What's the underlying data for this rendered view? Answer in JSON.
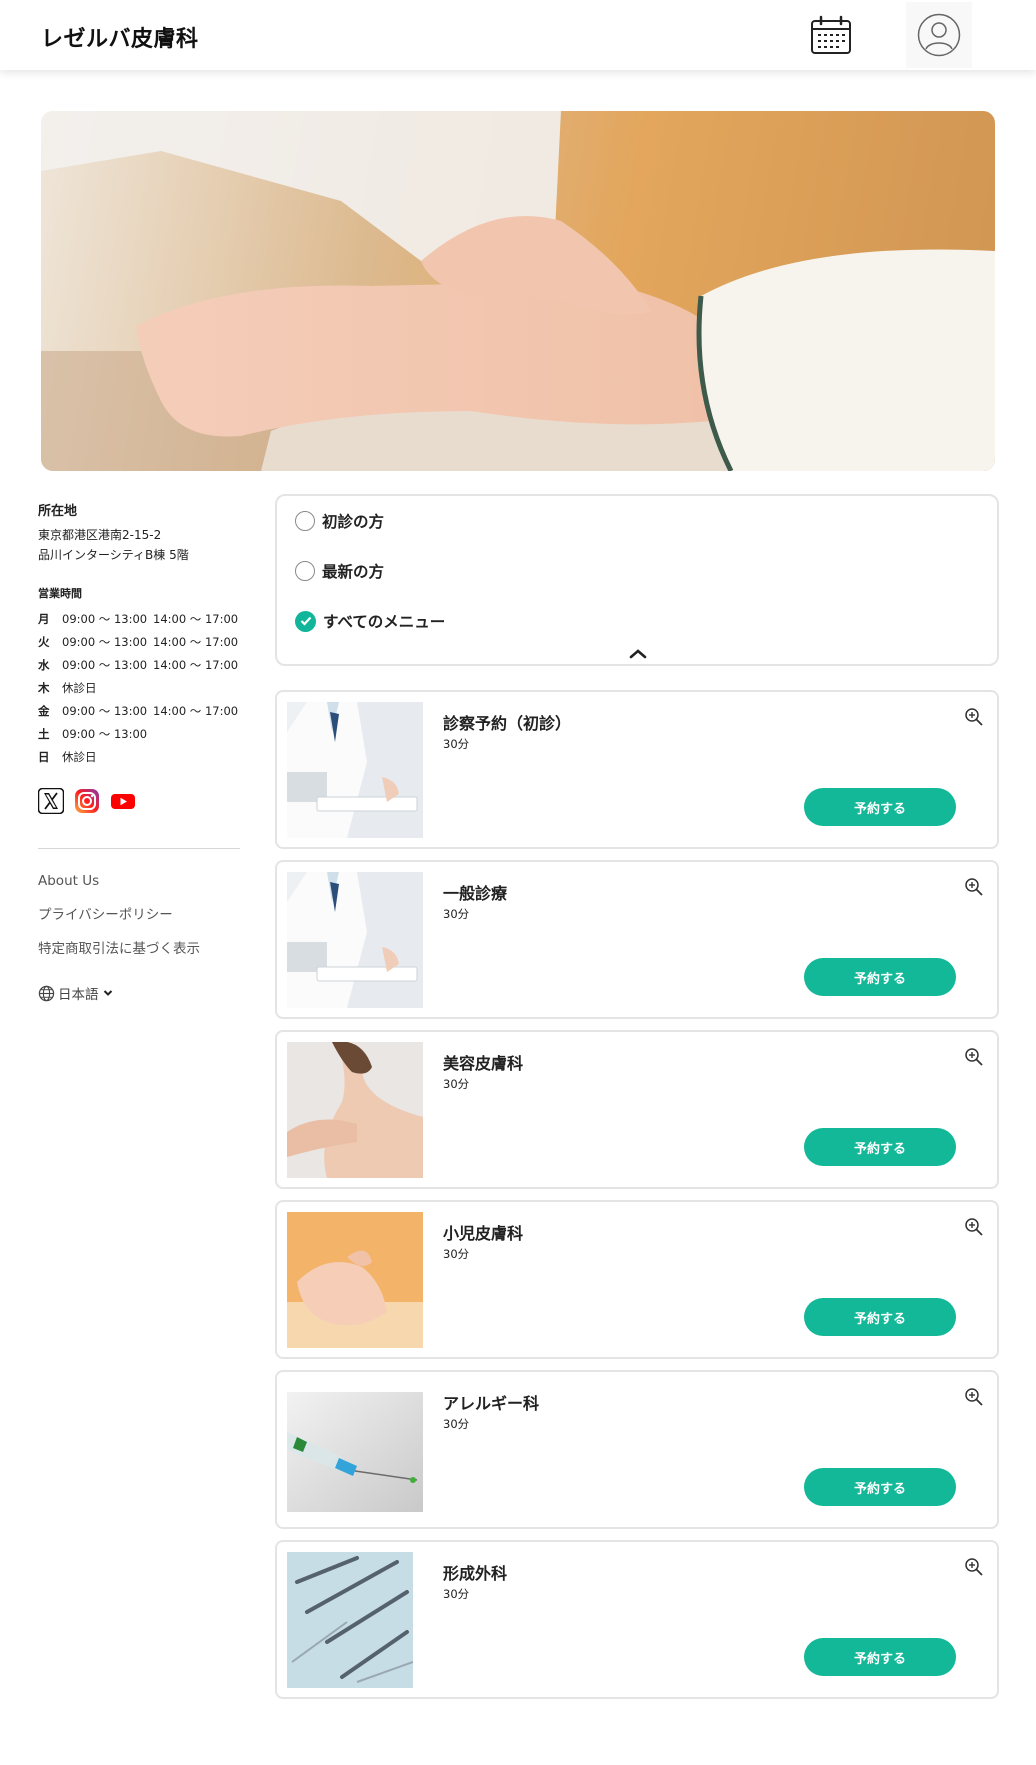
{
  "header": {
    "brand": "レゼルバ皮膚科",
    "calendar_icon": "calendar-icon",
    "user_icon": "user-avatar-icon"
  },
  "hero": {
    "image": "doctor-checking-pulse-photo"
  },
  "sidebar": {
    "location_title": "所在地",
    "address_line1": "東京都港区港南2-15-2",
    "address_line2": "品川インターシティB棟 5階",
    "hours_title": "営業時間",
    "hours": [
      {
        "day": "月",
        "morning": "09:00 ～ 13:00",
        "afternoon": "14:00 ～ 17:00"
      },
      {
        "day": "火",
        "morning": "09:00 ～ 13:00",
        "afternoon": "14:00 ～ 17:00"
      },
      {
        "day": "水",
        "morning": "09:00 ～ 13:00",
        "afternoon": "14:00 ～ 17:00"
      },
      {
        "day": "木",
        "morning": "休診日",
        "afternoon": ""
      },
      {
        "day": "金",
        "morning": "09:00 ～ 13:00",
        "afternoon": "14:00 ～ 17:00"
      },
      {
        "day": "土",
        "morning": "09:00 ～ 13:00",
        "afternoon": ""
      },
      {
        "day": "日",
        "morning": "休診日",
        "afternoon": ""
      }
    ],
    "social": [
      "x-icon",
      "instagram-icon",
      "youtube-icon"
    ],
    "links": [
      "About Us",
      "プライバシーポリシー",
      "特定商取引法に基づく表示"
    ],
    "language": "日本語"
  },
  "filter": {
    "options": [
      {
        "label": "初診の方",
        "selected": false
      },
      {
        "label": "最新の方",
        "selected": false
      },
      {
        "label": "すべてのメニュー",
        "selected": true
      }
    ]
  },
  "colors": {
    "accent": "#12b898",
    "border": "#e4e4e4"
  },
  "menus": [
    {
      "title": "診察予約（初診）",
      "duration": "30分",
      "button": "予約する",
      "image": "doctor-writing-photo"
    },
    {
      "title": "一般診療",
      "duration": "30分",
      "button": "予約する",
      "image": "doctor-writing-photo"
    },
    {
      "title": "美容皮膚科",
      "duration": "30分",
      "button": "予約する",
      "image": "shoulder-skin-photo"
    },
    {
      "title": "小児皮膚科",
      "duration": "30分",
      "button": "予約する",
      "image": "baby-hand-photo"
    },
    {
      "title": "アレルギー科",
      "duration": "30分",
      "button": "予約する",
      "image": "syringe-photo"
    },
    {
      "title": "形成外科",
      "duration": "30分",
      "button": "予約する",
      "image": "surgical-tools-photo"
    }
  ]
}
